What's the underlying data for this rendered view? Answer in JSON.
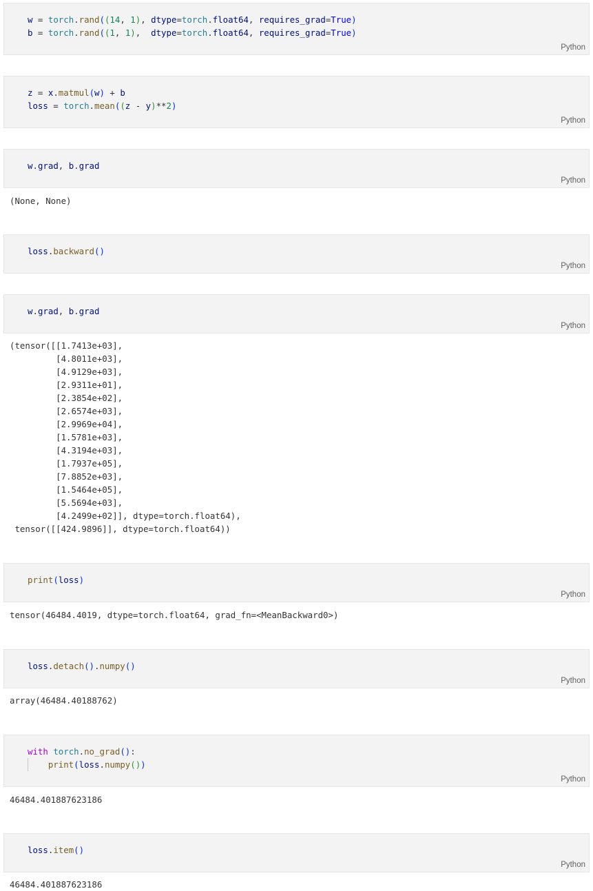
{
  "cells": [
    {
      "lang": "Python",
      "lines": [
        [
          "w",
          " = ",
          "torch",
          ".",
          "rand",
          "(",
          "(",
          "14",
          ", ",
          "1",
          ")",
          ", ",
          "dtype",
          "=",
          "torch",
          ".",
          "float64",
          ", ",
          "requires_grad",
          "=",
          "True",
          ")"
        ],
        [
          "b",
          " = ",
          "torch",
          ".",
          "rand",
          "(",
          "(",
          "1",
          ", ",
          "1",
          ")",
          ",  ",
          "dtype",
          "=",
          "torch",
          ".",
          "float64",
          ", ",
          "requires_grad",
          "=",
          "True",
          ")"
        ]
      ]
    },
    {
      "lang": "Python",
      "lines": [
        [
          "z",
          " = ",
          "x",
          ".",
          "matmul",
          "(",
          "w",
          ")",
          " + ",
          "b"
        ],
        [
          "loss",
          " = ",
          "torch",
          ".",
          "mean",
          "(",
          "(",
          "z",
          " - ",
          "y",
          ")",
          "**",
          "2",
          ")"
        ]
      ]
    },
    {
      "lang": "Python",
      "lines": [
        [
          "w",
          ".",
          "grad",
          ", ",
          "b",
          ".",
          "grad"
        ]
      ],
      "output": "(None, None)"
    },
    {
      "lang": "Python",
      "lines": [
        [
          "loss",
          ".",
          "backward",
          "()"
        ]
      ]
    },
    {
      "lang": "Python",
      "lines": [
        [
          "w",
          ".",
          "grad",
          ", ",
          "b",
          ".",
          "grad"
        ]
      ],
      "output": "(tensor([[1.7413e+03],\n         [4.8011e+03],\n         [4.9129e+03],\n         [2.9311e+01],\n         [2.3854e+02],\n         [2.6574e+03],\n         [2.9969e+04],\n         [1.5781e+03],\n         [4.3194e+03],\n         [1.7937e+05],\n         [7.8852e+03],\n         [1.5464e+05],\n         [5.5694e+03],\n         [4.2499e+02]], dtype=torch.float64),\n tensor([[424.9896]], dtype=torch.float64))"
    },
    {
      "lang": "Python",
      "lines": [
        [
          "print",
          "(",
          "loss",
          ")"
        ]
      ],
      "output": "tensor(46484.4019, dtype=torch.float64, grad_fn=<MeanBackward0>)"
    },
    {
      "lang": "Python",
      "lines": [
        [
          "loss",
          ".",
          "detach",
          "()",
          ".",
          "numpy",
          "()"
        ]
      ],
      "output": "array(46484.40188762)"
    },
    {
      "lang": "Python",
      "lines": [
        [
          "with",
          " ",
          "torch",
          ".",
          "no_grad",
          "()",
          ":"
        ],
        [
          "    ",
          "print",
          "(",
          "loss",
          ".",
          "numpy",
          "()",
          ")"
        ]
      ],
      "output": "46484.401887623186"
    },
    {
      "lang": "Python",
      "lines": [
        [
          "loss",
          ".",
          "item",
          "()"
        ]
      ],
      "output": "46484.401887623186"
    }
  ]
}
